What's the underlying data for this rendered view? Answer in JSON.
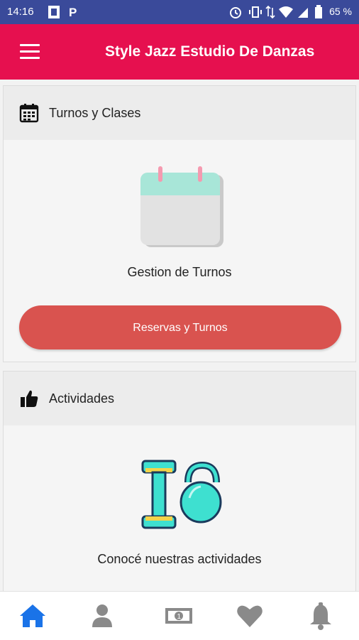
{
  "status_bar": {
    "time": "14:16",
    "battery": "65 %"
  },
  "app_bar": {
    "title": "Style Jazz Estudio De Danzas",
    "menu_icon": "hamburger-menu-icon"
  },
  "sections": [
    {
      "header": "Turnos y Clases",
      "header_icon": "calendar-icon",
      "illustration": "calendar-illustration",
      "caption": "Gestion de Turnos",
      "button_label": "Reservas y Turnos"
    },
    {
      "header": "Actividades",
      "header_icon": "thumbs-up-icon",
      "illustration": "dumbbell-kettlebell-illustration",
      "caption": "Conocé nuestras actividades"
    }
  ],
  "bottom_nav": [
    {
      "icon": "home-icon",
      "active": true
    },
    {
      "icon": "user-icon",
      "active": false
    },
    {
      "icon": "money-icon",
      "active": false
    },
    {
      "icon": "heart-icon",
      "active": false
    },
    {
      "icon": "bell-icon",
      "active": false
    }
  ],
  "colors": {
    "status_bar": "#3a4a9a",
    "app_bar": "#e6104f",
    "button": "#d9534f",
    "nav_active": "#1a73e8",
    "nav_inactive": "#8a8a8a"
  }
}
